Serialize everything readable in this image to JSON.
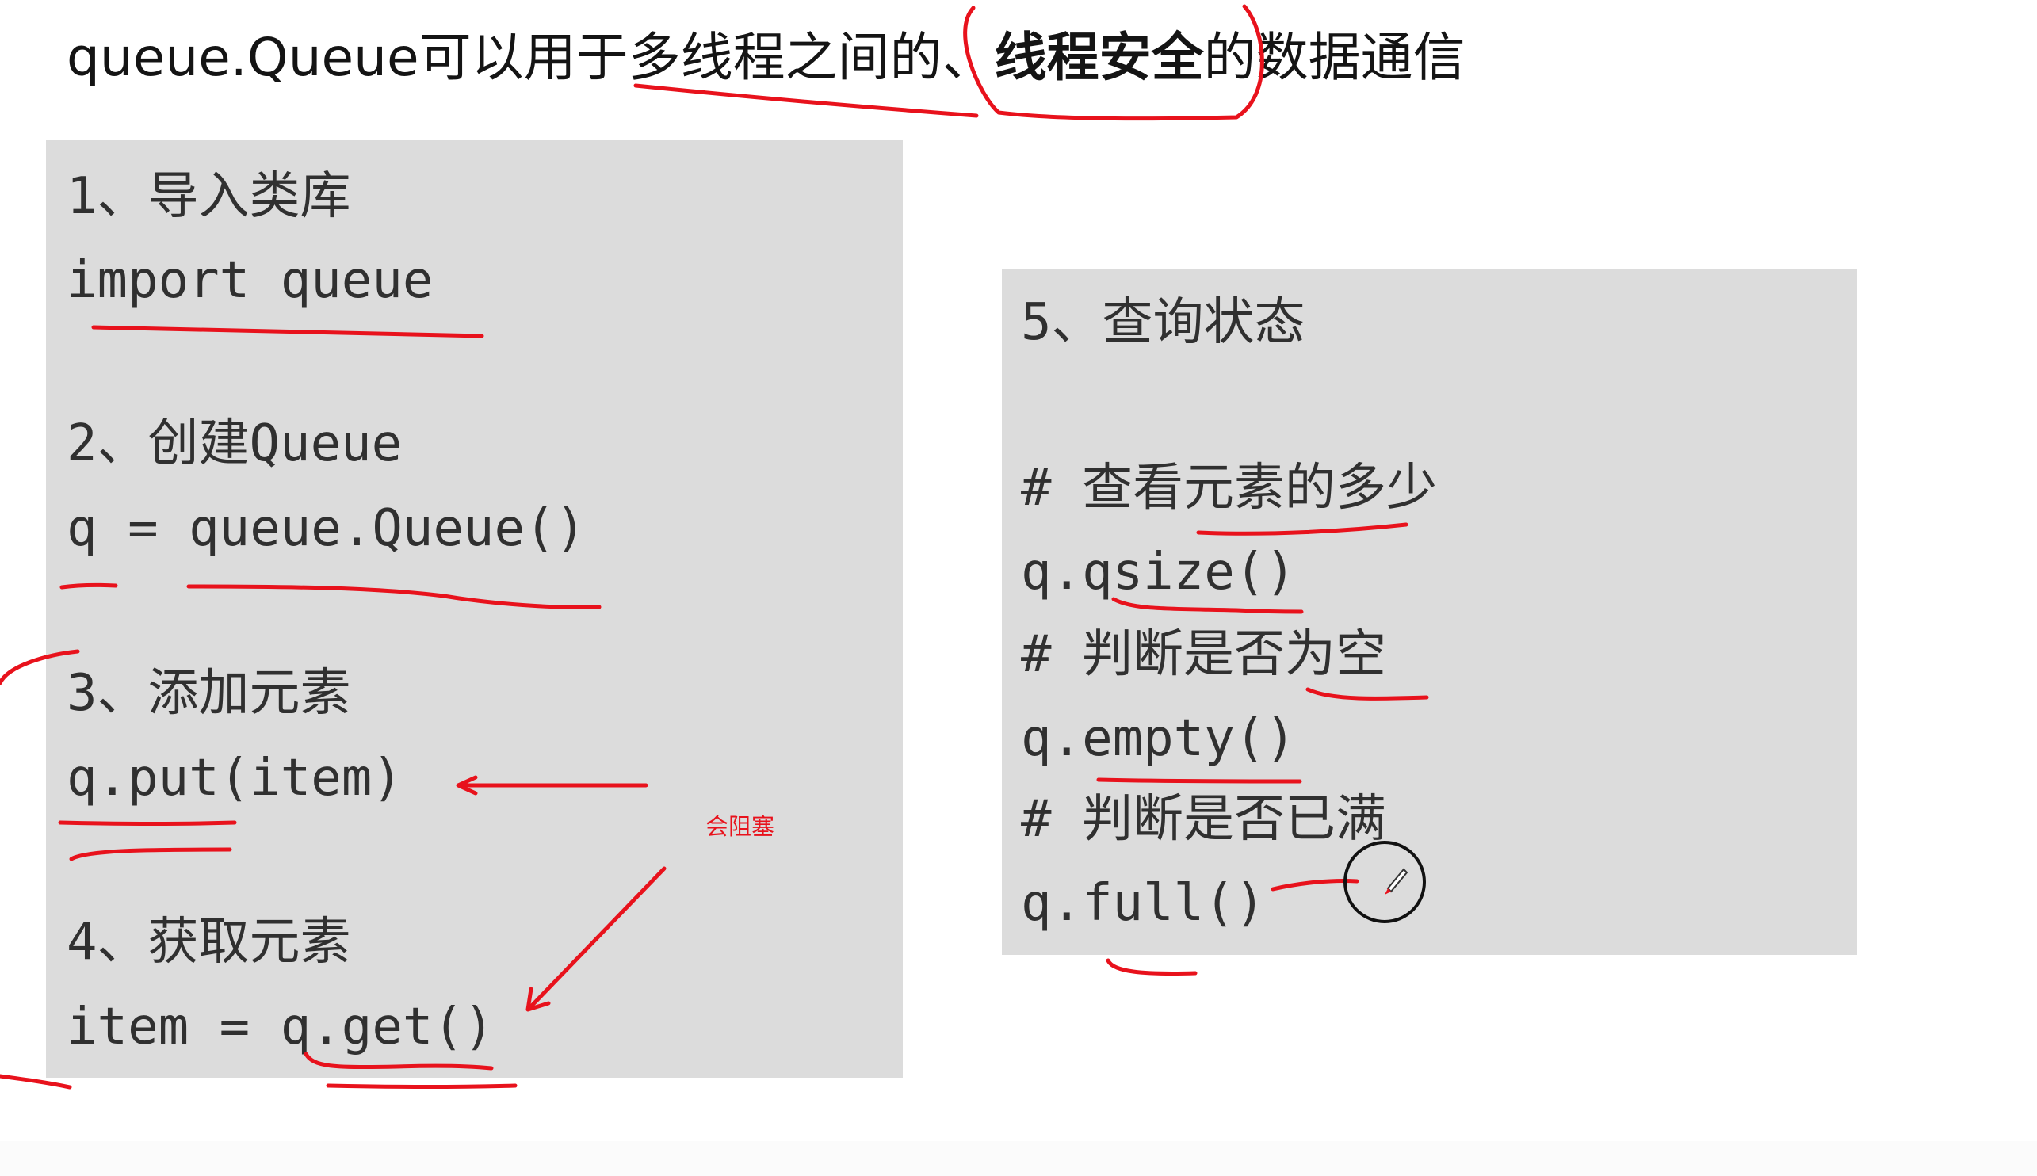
{
  "heading": {
    "before": "queue.Queue可以用于多线程之间的、",
    "emphasis": "线程安全",
    "after": "的数据通信"
  },
  "left_panel": {
    "step1": "1、导入类库",
    "code1": "import queue",
    "step2": "2、创建Queue",
    "code2": "q = queue.Queue()",
    "step3": "3、添加元素",
    "code3": "q.put(item)",
    "step4": "4、获取元素",
    "code4": "item = q.get()"
  },
  "right_panel": {
    "step5": "5、查询状态",
    "comment_size": "# 查看元素的多少",
    "code_size": "q.qsize()",
    "comment_empty": "# 判断是否为空",
    "code_empty": "q.empty()",
    "comment_full": "# 判断是否已满",
    "code_full": "q.full()"
  },
  "annotation": {
    "note": "会阻塞",
    "ink_color": "#e8121c"
  },
  "cursor": {
    "icon": "pen-cursor-icon"
  }
}
